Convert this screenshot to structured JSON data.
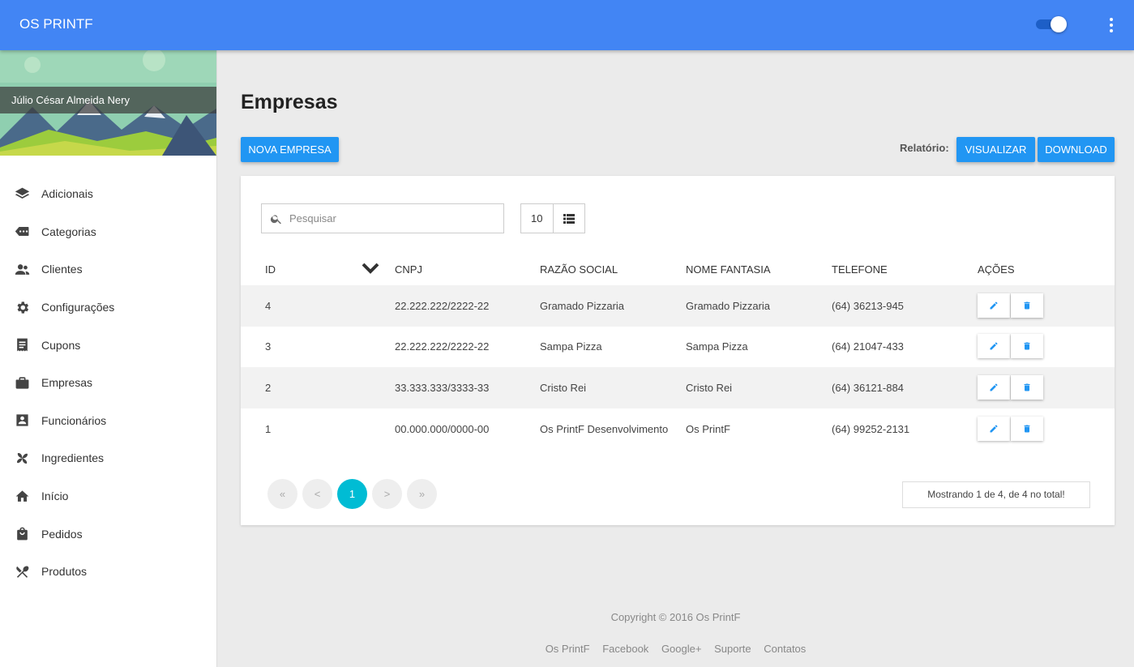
{
  "app": {
    "title": "OS PRINTF"
  },
  "user": {
    "name": "Júlio César Almeida Nery"
  },
  "sidebar": {
    "items": [
      {
        "label": "Adicionais",
        "icon": "layers-icon"
      },
      {
        "label": "Categorias",
        "icon": "label-icon"
      },
      {
        "label": "Clientes",
        "icon": "people-icon"
      },
      {
        "label": "Configurações",
        "icon": "gear-icon"
      },
      {
        "label": "Cupons",
        "icon": "receipt-icon"
      },
      {
        "label": "Empresas",
        "icon": "briefcase-icon"
      },
      {
        "label": "Funcionários",
        "icon": "contact-card-icon"
      },
      {
        "label": "Ingredientes",
        "icon": "pinwheel-icon"
      },
      {
        "label": "Início",
        "icon": "home-icon"
      },
      {
        "label": "Pedidos",
        "icon": "shopping-bag-icon"
      },
      {
        "label": "Produtos",
        "icon": "utensils-icon"
      }
    ]
  },
  "page": {
    "title": "Empresas",
    "new_button": "NOVA EMPRESA",
    "report_label": "Relatório:",
    "view_button": "VISUALIZAR",
    "download_button": "DOWNLOAD"
  },
  "search": {
    "placeholder": "Pesquisar",
    "page_size": "10"
  },
  "table": {
    "headers": [
      "ID",
      "CNPJ",
      "RAZÃO SOCIAL",
      "NOME FANTASIA",
      "TELEFONE",
      "AÇÕES"
    ],
    "rows": [
      [
        "4",
        "22.222.222/2222-22",
        "Gramado Pizzaria",
        "Gramado Pizzaria",
        "(64) 36213-945"
      ],
      [
        "3",
        "22.222.222/2222-22",
        "Sampa Pizza",
        "Sampa Pizza",
        "(64) 21047-433"
      ],
      [
        "2",
        "33.333.333/3333-33",
        "Cristo Rei",
        "Cristo Rei",
        "(64) 36121-884"
      ],
      [
        "1",
        "00.000.000/0000-00",
        "Os PrintF Desenvolvimento",
        "Os PrintF",
        "(64) 99252-2131"
      ]
    ]
  },
  "pagination": {
    "first": "«",
    "prev": "<",
    "current": "1",
    "next": ">",
    "last": "»",
    "summary": "Mostrando 1 de 4, de 4 no total!"
  },
  "footer": {
    "copyright": "Copyright © 2016 Os PrintF",
    "links": [
      "Os PrintF",
      "Facebook",
      "Google+",
      "Suporte",
      "Contatos"
    ]
  },
  "colors": {
    "topbar": "#4285f4",
    "button": "#2196f3",
    "active_page": "#00bcd4"
  }
}
